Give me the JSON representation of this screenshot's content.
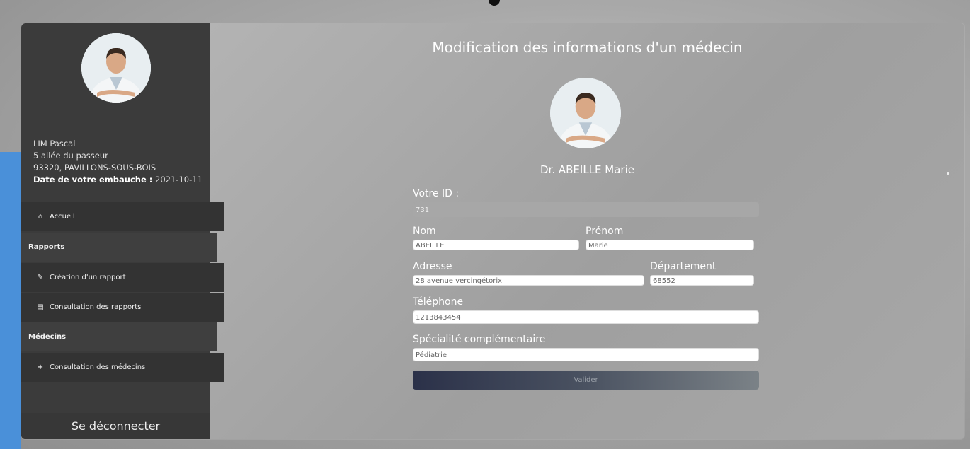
{
  "sidebar": {
    "user": {
      "name": "LIM Pascal",
      "address": "5 allée du passeur",
      "city": "93320, PAVILLONS-SOUS-BOIS",
      "hire_label": "Date de votre embauche :",
      "hire_date": "2021-10-11"
    },
    "menu": {
      "home": "Accueil",
      "reports_section": "Rapports",
      "create_report": "Création d'un rapport",
      "view_reports": "Consultation des rapports",
      "doctors_section": "Médecins",
      "view_doctors": "Consultation des médecins"
    },
    "logout": "Se déconnecter"
  },
  "main": {
    "title": "Modification des informations d'un médecin",
    "doctor_name": "Dr. ABEILLE Marie",
    "form": {
      "id_label": "Votre ID :",
      "id_value": "731",
      "nom_label": "Nom",
      "nom_value": "ABEILLE",
      "prenom_label": "Prénom",
      "prenom_value": "Marie",
      "adresse_label": "Adresse",
      "adresse_value": "28 avenue vercingétorix",
      "departement_label": "Département",
      "departement_value": "68552",
      "telephone_label": "Téléphone",
      "telephone_value": "1213843454",
      "specialite_label": "Spécialité complémentaire",
      "specialite_value": "Pédiatrie",
      "submit": "Valider"
    }
  },
  "icons": {
    "home": "home-icon",
    "create": "report-create-icon",
    "book": "book-icon",
    "plus": "plus-icon"
  }
}
